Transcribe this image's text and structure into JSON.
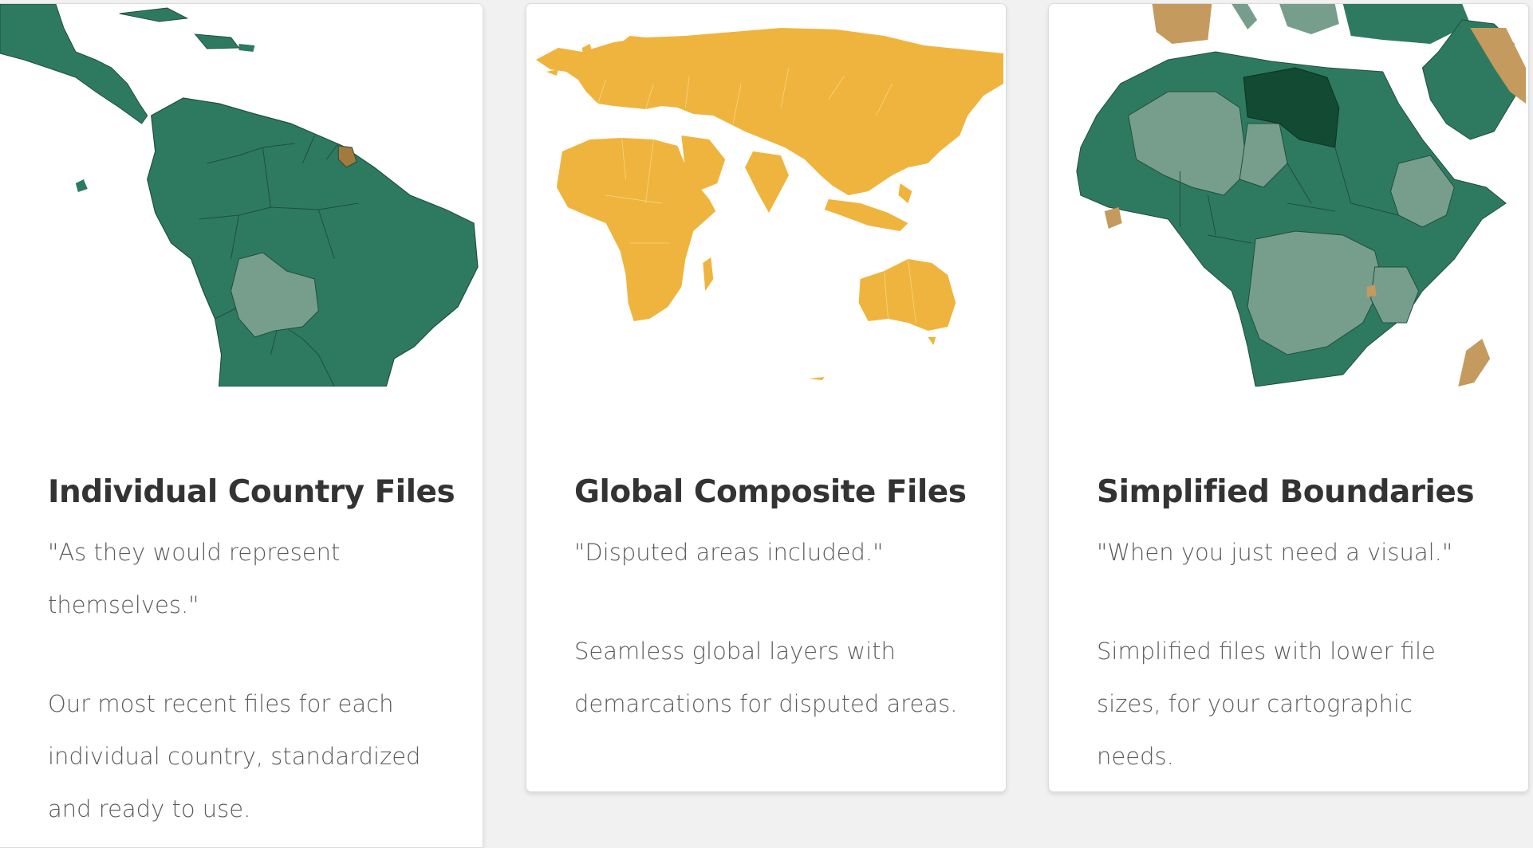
{
  "colors": {
    "green": "#2e7a60",
    "green_light": "#779e8d",
    "green_dark": "#124a33",
    "tan": "#c49a5e",
    "yellow": "#efb43d"
  },
  "cards": [
    {
      "map_icon": "south-america-map",
      "title": "Individual Country Files",
      "quote": "\"As they would represent themselves.\"",
      "description": "Our most recent files for each individual country, standardized and ready to use."
    },
    {
      "map_icon": "world-map",
      "title": "Global Composite Files",
      "quote": "\"Disputed areas included.\"",
      "description": "Seamless global layers with demarcations for disputed areas."
    },
    {
      "map_icon": "africa-map",
      "title": "Simplified Boundaries",
      "quote": "\"When you just need a visual.\"",
      "description": "Simplified files with lower file sizes, for your cartographic needs."
    }
  ]
}
